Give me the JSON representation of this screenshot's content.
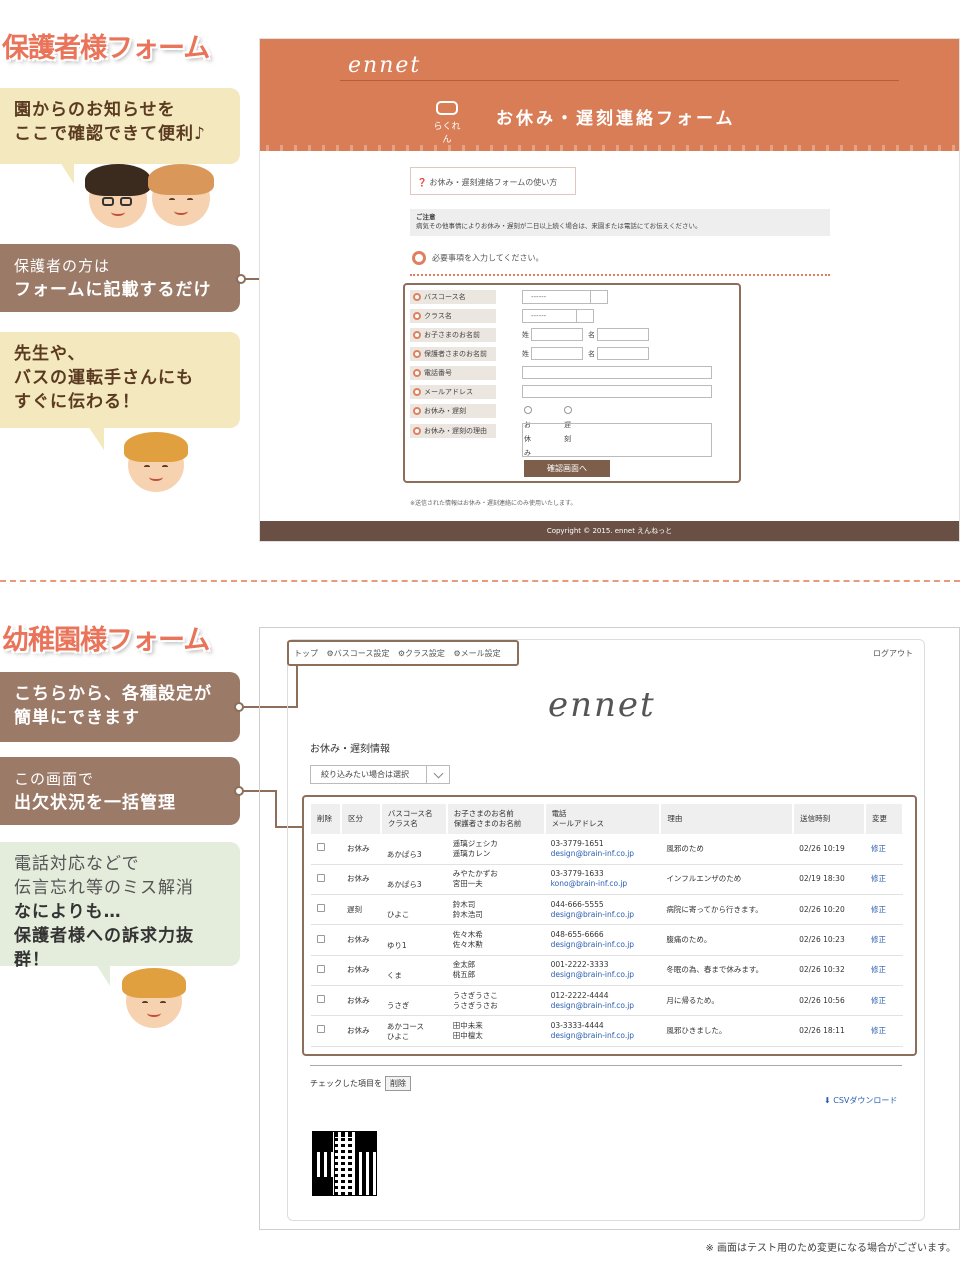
{
  "parent_section": {
    "title": "保護者様フォーム",
    "bubbles": [
      {
        "lines": [
          "園からのお知らせを",
          "ここで確認できて便利♪"
        ]
      },
      {
        "lines": [
          "保護者の方は",
          "フォームに記載するだけ"
        ]
      },
      {
        "lines": [
          "先生や、",
          "バスの運転手さんにも",
          "すぐに伝わる！"
        ]
      }
    ]
  },
  "parent_form": {
    "logo": "ennet",
    "mark_caption": "らくれん",
    "title": "お休み・遅刻連絡フォーム",
    "howto_link": "❓ お休み・遅刻連絡フォームの使い方",
    "note_title": "ご注意",
    "note_text": "病気その他事情によりお休み・遅刻が二日以上続く場合は、来園または電話にてお伝えください。",
    "required_text": "必要事項を入力してください。",
    "fields": {
      "bus_course": "バスコース名",
      "class": "クラス名",
      "child_name": "お子さまのお名前",
      "guardian_name": "保護者さまのお名前",
      "phone": "電話番号",
      "email": "メールアドレス",
      "absence_late": "お休み・遅刻",
      "reason": "お休み・遅刻の理由"
    },
    "select_placeholder": "------",
    "last_name": "姓",
    "first_name": "名",
    "radio_absence": "お休み",
    "radio_late": "遅刻",
    "confirm_button": "確認画面へ",
    "privacy_note": "※送信された情報はお休み・遅刻連絡にのみ使用いたします。",
    "copyright": "Copyright © 2015. ennet えんねっと"
  },
  "admin_section": {
    "title": "幼稚園様フォーム",
    "bubbles": [
      {
        "lines": [
          "こちらから、各種設定が",
          "簡単にできます"
        ]
      },
      {
        "lines": [
          "この画面で",
          "出欠状況を一括管理"
        ]
      },
      {
        "lines": [
          "電話対応などで",
          "伝言忘れ等のミス解消",
          "なによりも…",
          "保護者様への訴求力抜群！"
        ]
      }
    ]
  },
  "admin_panel": {
    "nav": [
      "トップ",
      "⚙バスコース設定",
      "⚙クラス設定",
      "⚙メール設定"
    ],
    "logout": "ログアウト",
    "logo": "ennet",
    "heading": "お休み・遅刻情報",
    "filter_placeholder": "絞り込みたい場合は選択",
    "columns": {
      "delete": "削除",
      "type": "区分",
      "bus": "バスコース名",
      "class": "クラス名",
      "child": "お子さまのお名前",
      "guardian": "保護者さまのお名前",
      "phone": "電話",
      "email": "メールアドレス",
      "reason": "理由",
      "sent": "送信時刻",
      "edit": "変更"
    },
    "rows": [
      {
        "type": "お休み",
        "bus": "",
        "class": "あかぱら3",
        "child": "遥璃ジェシカ",
        "guardian": "遥璃カレン",
        "phone": "03-3779-1651",
        "email": "design@brain-inf.co.jp",
        "reason": "風邪のため",
        "sent": "02/26 10:19",
        "edit": "修正"
      },
      {
        "type": "お休み",
        "bus": "",
        "class": "あかぱら3",
        "child": "みやたかずお",
        "guardian": "宮田一夫",
        "phone": "03-3779-1633",
        "email": "kono@brain-inf.co.jp",
        "reason": "インフルエンザのため",
        "sent": "02/19 18:30",
        "edit": "修正"
      },
      {
        "type": "遅刻",
        "bus": "",
        "class": "ひよこ",
        "child": "鈴木司",
        "guardian": "鈴木浩司",
        "phone": "044-666-5555",
        "email": "design@brain-inf.co.jp",
        "reason": "病院に寄ってから行きます。",
        "sent": "02/26 10:20",
        "edit": "修正"
      },
      {
        "type": "お休み",
        "bus": "",
        "class": "ゆり1",
        "child": "佐々木希",
        "guardian": "佐々木勲",
        "phone": "048-655-6666",
        "email": "design@brain-inf.co.jp",
        "reason": "腹痛のため。",
        "sent": "02/26 10:23",
        "edit": "修正"
      },
      {
        "type": "お休み",
        "bus": "",
        "class": "くま",
        "child": "金太郎",
        "guardian": "桃五郎",
        "phone": "001-2222-3333",
        "email": "design@brain-inf.co.jp",
        "reason": "冬眠の為、春まで休みます。",
        "sent": "02/26 10:32",
        "edit": "修正"
      },
      {
        "type": "お休み",
        "bus": "",
        "class": "うさぎ",
        "child": "うさぎうさこ",
        "guardian": "うさぎうさお",
        "phone": "012-2222-4444",
        "email": "design@brain-inf.co.jp",
        "reason": "月に帰るため。",
        "sent": "02/26 10:56",
        "edit": "修正"
      },
      {
        "type": "お休み",
        "bus": "あかコース",
        "class": "ひよこ",
        "child": "田中未来",
        "guardian": "田中檀太",
        "phone": "03-3333-4444",
        "email": "design@brain-inf.co.jp",
        "reason": "風邪ひきました。",
        "sent": "02/26 18:11",
        "edit": "修正"
      }
    ],
    "bulk_label": "チェックした項目を",
    "bulk_button": "削除",
    "csv_link": "⬇ CSVダウンロード"
  },
  "footnote": "※ 画面はテスト用のため変更になる場合がございます。",
  "colors": {
    "accent": "#e9745a",
    "header": "#d97d57",
    "brown": "#8d6e5a",
    "cream": "#f4e8bf",
    "mint": "#e4ecdc"
  }
}
